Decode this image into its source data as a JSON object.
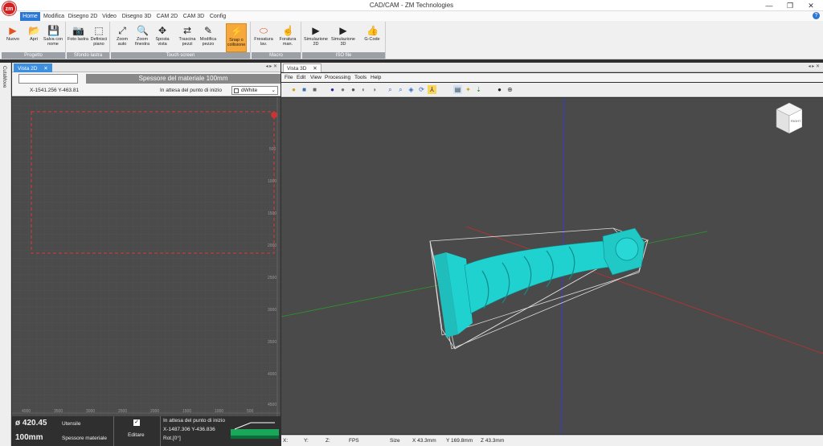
{
  "app": {
    "title": "CAD/CAM - ZM Technologies",
    "logo": "zm"
  },
  "window_controls": {
    "minimize": "—",
    "maximize": "❐",
    "close": "✕"
  },
  "ribbon_tabs": [
    "Home",
    "Modifica",
    "Disegno 2D",
    "Video",
    "Disegno 3D",
    "CAM 2D",
    "CAM 3D",
    "Config"
  ],
  "help_icon": "?",
  "ribbon_groups": [
    {
      "label": "Progetto",
      "buttons": [
        {
          "label": "Nuovo",
          "icon": "new-icon",
          "glyph": "▶"
        },
        {
          "label": "Apri",
          "icon": "open-icon",
          "glyph": "📂"
        },
        {
          "label": "Salva con nome",
          "icon": "save-icon",
          "glyph": "💾"
        }
      ]
    },
    {
      "label": "Sfondo lastra",
      "buttons": [
        {
          "label": "Foto lastra",
          "icon": "camera-icon",
          "glyph": "📷"
        },
        {
          "label": "Definisci piano",
          "icon": "plane-icon",
          "glyph": "⬚"
        }
      ]
    },
    {
      "label": "Touch screen",
      "buttons": [
        {
          "label": "Zoom auto",
          "icon": "zoom-auto-icon",
          "glyph": "⤢"
        },
        {
          "label": "Zoom finestra",
          "icon": "zoom-window-icon",
          "glyph": "🔍"
        },
        {
          "label": "Sposta vista",
          "icon": "move-view-icon",
          "glyph": "✥"
        },
        {
          "label": "Trascina pezzi",
          "icon": "drag-pieces-icon",
          "glyph": "⇄"
        },
        {
          "label": "Modifica pezzo",
          "icon": "edit-piece-icon",
          "glyph": "✎"
        },
        {
          "label": "Snap o collisione",
          "icon": "snap-icon",
          "glyph": "⚡"
        }
      ]
    },
    {
      "label": "Macro",
      "buttons": [
        {
          "label": "Fresatura lav.",
          "icon": "milling-icon",
          "glyph": "⬭"
        },
        {
          "label": "Foratura man.",
          "icon": "drilling-icon",
          "glyph": "☝"
        }
      ]
    },
    {
      "label": "ISO file",
      "buttons": [
        {
          "label": "Simulazione 2D",
          "icon": "sim2d-icon",
          "glyph": "▶"
        },
        {
          "label": "Simulazione 3D",
          "icon": "sim3d-icon",
          "glyph": "▶"
        },
        {
          "label": "G-Code",
          "icon": "gcode-icon",
          "glyph": "👍"
        }
      ]
    }
  ],
  "side_strip": {
    "label": "CutaMove"
  },
  "left_panel": {
    "tab": "Vista 2D",
    "tab_close": "✕",
    "input_value": "",
    "thickness_banner": "Spessore del materiale 100mm",
    "coords": "X-1541.256 Y-463.81",
    "waiting": "In attesa del punto di inizio",
    "color_select": "dWhite",
    "ruler_left": [
      "500",
      "1000",
      "1500",
      "2000",
      "2500",
      "3000",
      "3500",
      "4000",
      "4500"
    ],
    "ruler_bottom": [
      "4000",
      "3500",
      "3000",
      "2500",
      "2000",
      "1500",
      "1000",
      "500"
    ]
  },
  "left_status": {
    "diameter": "ø 420.45",
    "tool_label": "Utensile",
    "thickness_value": "100mm",
    "thickness_label": "Spessore materiale",
    "edit_label": "Editare",
    "waiting": "In attesa del punto di inizio",
    "coords": "X-1487.306 Y-436.836",
    "rotation": "Rot.[0°]"
  },
  "right_panel": {
    "tab": "Vista 3D",
    "tab_close": "✕",
    "menu": [
      "File",
      "Edit",
      "View",
      "Processing",
      "Tools",
      "Help"
    ],
    "cube_label": "RIGHT"
  },
  "right_status": {
    "x_label": "X:",
    "y_label": "Y:",
    "z_label": "Z:",
    "fps_label": "FPS",
    "size_label": "Size",
    "size_x": "X 43.3mm",
    "size_y": "Y 169.8mm",
    "size_z": "Z 43.3mm"
  },
  "colors": {
    "accent": "#2b77d6",
    "ribbon_active": "#f6a83a",
    "canvas_bg": "#4a4a4a",
    "model": "#1fd1cf",
    "dash": "#d83a3a"
  }
}
